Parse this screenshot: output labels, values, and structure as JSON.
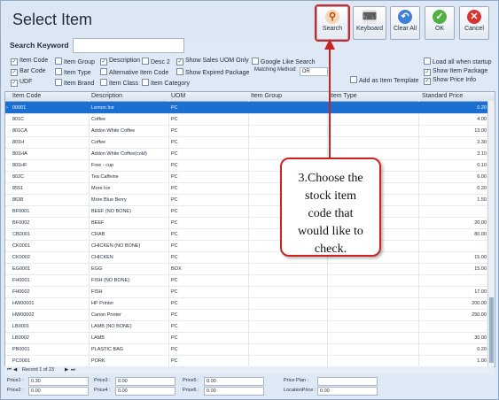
{
  "window": {
    "title": "Select Item"
  },
  "toolbar": {
    "search_label": "Search",
    "keyboard_label": "Keyboard",
    "clear_all_label": "Clear All",
    "ok_label": "OK",
    "cancel_label": "Cancel"
  },
  "search": {
    "keyword_label": "Search Keyword",
    "keyword_value": ""
  },
  "options": {
    "item_code": "Item Code",
    "item_group": "Item Group",
    "description": "Description",
    "desc2": "Desc 2",
    "show_sales_uom_only": "Show Sales UOM Only",
    "google_like_search": "Google Like Search",
    "load_all_when_startup": "Load all when startup",
    "bar_code": "Bar Code",
    "item_type": "Item Type",
    "alternative_item_code": "Alternative Item Code",
    "show_expired_package": "Show Expired Package",
    "matching_method_label": "Matching Method:",
    "matching_method_value": "OR",
    "show_item_package": "Show Item Package",
    "udf": "UDF",
    "item_brand": "Item Brand",
    "item_class": "Item Class",
    "item_category": "Item Category",
    "add_as_item_template": "Add as Item Template",
    "show_price_info": "Show Price Info"
  },
  "grid": {
    "columns": [
      "Item Code",
      "Description",
      "UOM",
      "Item Group",
      "Item Type",
      "Standard Price"
    ],
    "rows": [
      {
        "code": "00001",
        "desc": "Lemon Ice",
        "uom": "PC",
        "price": "0.20"
      },
      {
        "code": "801C",
        "desc": "Coffee",
        "uom": "PC",
        "price": "4.00"
      },
      {
        "code": "801CA",
        "desc": "Addon White Coffee",
        "uom": "PC",
        "price": "13.00"
      },
      {
        "code": "801H",
        "desc": "Coffee",
        "uom": "PC",
        "price": "2.30"
      },
      {
        "code": "801HA",
        "desc": "Addon White Coffee(cold)",
        "uom": "PC",
        "price": "3.10"
      },
      {
        "code": "801HF",
        "desc": "Free - cup",
        "uom": "PC",
        "price": "0.10"
      },
      {
        "code": "802C",
        "desc": "Tea Caffeine",
        "uom": "PC",
        "price": "6.00"
      },
      {
        "code": "8551",
        "desc": "More Ice",
        "uom": "PC",
        "price": "0.20"
      },
      {
        "code": "8638",
        "desc": "More Blue Berry",
        "uom": "PC",
        "price": "1.50"
      },
      {
        "code": "BF0001",
        "desc": "BEEF (NO BONE)",
        "uom": "PC",
        "price": ""
      },
      {
        "code": "BF0002",
        "desc": "BEEF",
        "uom": "PC",
        "price": "20.00"
      },
      {
        "code": "CB0001",
        "desc": "CRAB",
        "uom": "PC",
        "price": "80.00"
      },
      {
        "code": "CK0001",
        "desc": "CHICKEN (NO BONE)",
        "uom": "PC",
        "price": ""
      },
      {
        "code": "CK0002",
        "desc": "CHICKEN",
        "uom": "PC",
        "price": "15.00"
      },
      {
        "code": "EG0001",
        "desc": "EGG",
        "uom": "BOX",
        "price": "15.00"
      },
      {
        "code": "FH0001",
        "desc": "FISH (NO BONE)",
        "uom": "PC",
        "price": ""
      },
      {
        "code": "FH0002",
        "desc": "FISH",
        "uom": "PC",
        "price": "17.00"
      },
      {
        "code": "HW00001",
        "desc": "HP Printer",
        "uom": "PC",
        "price": "200.00"
      },
      {
        "code": "HW00002",
        "desc": "Canon Printer",
        "uom": "PC",
        "price": "250.00"
      },
      {
        "code": "LB0001",
        "desc": "LAMB (NO BONE)",
        "uom": "PC",
        "price": ""
      },
      {
        "code": "LB0002",
        "desc": "LAMB",
        "uom": "PC",
        "price": "30.00"
      },
      {
        "code": "PB0001",
        "desc": "PLASTIC BAG",
        "uom": "PC",
        "price": "0.20"
      },
      {
        "code": "PC0001",
        "desc": "PORK",
        "uom": "PC",
        "price": "1.00"
      }
    ]
  },
  "navigator": {
    "record_text": "Record 1 of 23"
  },
  "footer": {
    "price1_label": "Price1 :",
    "price1_value": "0.30",
    "price2_label": "Price2 :",
    "price2_value": "0.00",
    "price3_label": "Price3 :",
    "price3_value": "0.00",
    "price4_label": "Price4 :",
    "price4_value": "0.00",
    "price5_label": "Price5 :",
    "price5_value": "0.00",
    "price6_label": "Price6 :",
    "price6_value": "0.00",
    "price_plan_label": "Price Plan :",
    "price_plan_value": "",
    "location_price_label": "LocationPrice :",
    "location_price_value": "0.00"
  },
  "callout": {
    "lines": [
      "3.Choose the",
      "stock item",
      "code that",
      "would like to",
      "check."
    ]
  },
  "colors": {
    "accent": "#1a6fd1",
    "callout_border": "#cc2222"
  }
}
